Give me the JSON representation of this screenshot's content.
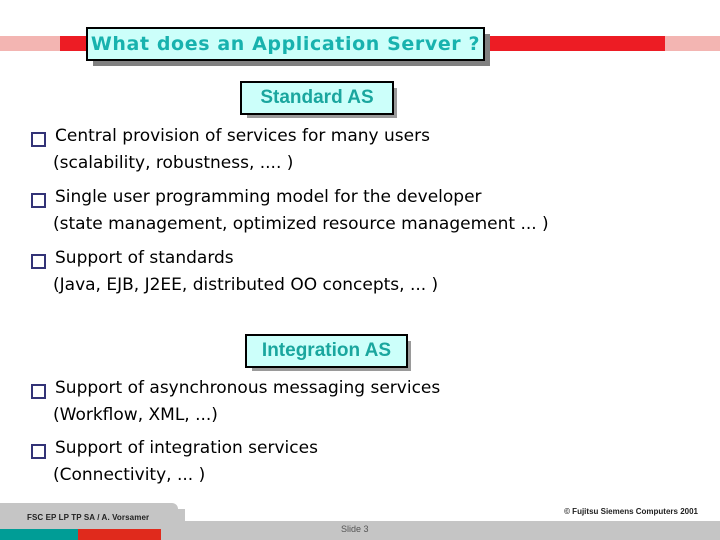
{
  "slide": {
    "title": "What does an Application Server ?",
    "sections": [
      {
        "heading": "Standard AS",
        "bullets": [
          {
            "main": "Central provision of services for many users",
            "sub": "(scalability, robustness, .... )"
          },
          {
            "main": "Single user programming model for the developer",
            "sub": "(state management, optimized resource management ... )"
          },
          {
            "main": "Support of standards",
            "sub": "(Java, EJB, J2EE, distributed OO concepts, ... )"
          }
        ]
      },
      {
        "heading": "Integration AS",
        "bullets": [
          {
            "main": "Support of asynchronous messaging services",
            "sub": "(Workflow, XML, ...)"
          },
          {
            "main": "Support of integration services",
            "sub": "(Connectivity, ... )"
          }
        ]
      }
    ]
  },
  "footer": {
    "left_text": "FSC EP LP TP SA / A. Vorsamer",
    "copyright": "© Fujitsu Siemens Computers 2001",
    "slide_number": "Slide 3"
  },
  "colors": {
    "title_text": "#18b2ae",
    "title_fill": "#ccfffa",
    "heading_text": "#1aa69e",
    "bar_red": "#ed1c24",
    "bar_pale_red": "#f3b5b2",
    "bullet_marker": "#333377",
    "footer_teal": "#009d96",
    "footer_red": "#e02a1c",
    "footer_gray": "#c5c5c5",
    "shadow_gray": "#808080"
  }
}
